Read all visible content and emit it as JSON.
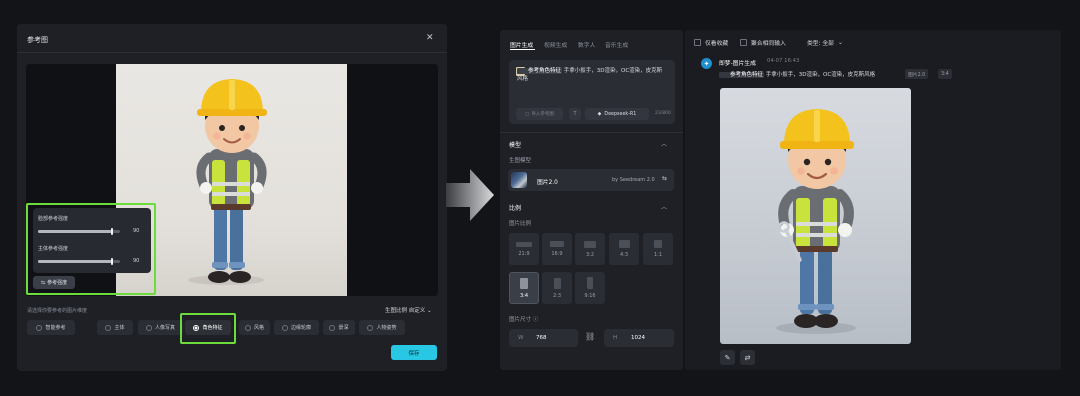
{
  "dialog": {
    "title": "参考图",
    "close_icon": "close-icon",
    "sliders": [
      {
        "label": "脸部参考强度",
        "value": 90
      },
      {
        "label": "主体参考强度",
        "value": 90
      }
    ],
    "strength_button": "参考强度",
    "hint": "请选择你要参考的图片维度",
    "ratio_select": "生图比例 自定义",
    "chips": [
      {
        "label": "智能参考",
        "selected": false
      },
      {
        "label": "主体",
        "selected": false
      },
      {
        "label": "人像写真",
        "selected": false
      },
      {
        "label": "角色特征",
        "selected": true
      },
      {
        "label": "风格",
        "selected": false
      },
      {
        "label": "边缘轮廓",
        "selected": false
      },
      {
        "label": "景深",
        "selected": false
      },
      {
        "label": "人物姿势",
        "selected": false
      }
    ],
    "save_label": "保存",
    "accent_color": "#28c8e4",
    "highlight_color": "#6cdc3c"
  },
  "generator": {
    "tabs": [
      {
        "label": "图片生成",
        "active": true
      },
      {
        "label": "视频生成",
        "active": false
      },
      {
        "label": "数字人",
        "active": false
      },
      {
        "label": "音乐生成",
        "active": false
      }
    ],
    "prompt": {
      "tag": "参考角色特征",
      "text": "手拿小扳手，3D渲染，OC渲染，皮克斯风格"
    },
    "add_ref_label": "导入参考图",
    "t_label": "T",
    "model_button": "Deepseek-R1",
    "char_count": "23/800",
    "model_section": {
      "title": "模型",
      "sub": "生图模型",
      "name": "图片2.0",
      "by": "by Seedream 2.0"
    },
    "ratio_section": {
      "title": "比例",
      "sub": "图片比例",
      "ratios": [
        {
          "label": "21:9",
          "selected": false
        },
        {
          "label": "16:9",
          "selected": false
        },
        {
          "label": "3:2",
          "selected": false
        },
        {
          "label": "4:3",
          "selected": false
        },
        {
          "label": "1:1",
          "selected": false
        },
        {
          "label": "3:4",
          "selected": true
        },
        {
          "label": "2:3",
          "selected": false
        },
        {
          "label": "9:16",
          "selected": false
        }
      ]
    },
    "size_section": {
      "title": "图片尺寸",
      "width_label": "W",
      "width": "768",
      "height_label": "H",
      "height": "1024"
    }
  },
  "history": {
    "filters": {
      "favorites": "仅看收藏",
      "aggregate": "聚合相同输入",
      "type": "类型: 全部"
    },
    "item": {
      "app": "即梦-图片生成",
      "time": "04-07 16:43",
      "tag": "参考角色特征",
      "prompt": "手拿小扳手，3D渲染，OC渲染，皮克斯风格",
      "model": "图片2.0",
      "ratio": "3:4"
    }
  }
}
